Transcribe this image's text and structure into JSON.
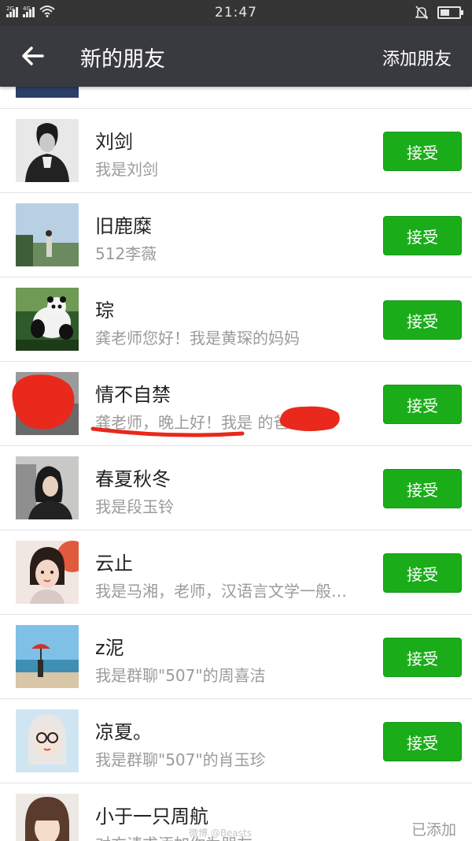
{
  "status_bar": {
    "sim1": "2G",
    "sim2": "4G",
    "time": "21:47",
    "battery_level": 0.5
  },
  "header": {
    "title": "新的朋友",
    "add_friend": "添加朋友"
  },
  "requests": [
    {
      "name": "刘剑",
      "message": "我是刘剑",
      "action": "接受"
    },
    {
      "name": "旧鹿糜",
      "message": "512李薇",
      "action": "接受"
    },
    {
      "name": "琮",
      "message": "龚老师您好！我是黄琛的妈妈",
      "action": "接受"
    },
    {
      "name": "情不自禁",
      "message": "龚老师，晚上好！我是 的爸…",
      "action": "接受"
    },
    {
      "name": "春夏秋冬",
      "message": "我是段玉铃",
      "action": "接受"
    },
    {
      "name": "云止",
      "message": "我是马湘，老师，汉语言文学一般…",
      "action": "接受"
    },
    {
      "name": "z泥",
      "message": "我是群聊\"507\"的周喜洁",
      "action": "接受"
    },
    {
      "name": "凉夏。",
      "message": "我是群聊\"507\"的肖玉珍",
      "action": "接受"
    },
    {
      "name": "小于一只周航",
      "message": "对方请求添加你为朋友",
      "action": "已添加"
    }
  ],
  "icons": {
    "back": "arrow-left-icon",
    "wifi": "wifi-icon",
    "mute": "bell-off-icon",
    "battery": "battery-icon"
  },
  "colors": {
    "accept_button": "#1aad19",
    "header": "#393a3f",
    "status_bar": "#353535",
    "annotation": "#e8291b"
  },
  "watermark": "微博 @Beasts"
}
